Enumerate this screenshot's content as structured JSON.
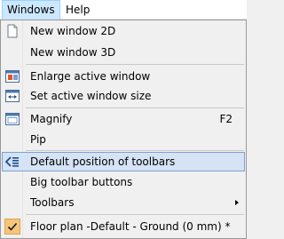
{
  "menubar": {
    "items": [
      {
        "label": "Windows",
        "active": true
      },
      {
        "label": "Help",
        "active": false
      }
    ]
  },
  "menu": {
    "new_window_2d": {
      "label": "New window 2D",
      "icon": "new-document-icon"
    },
    "new_window_3d": {
      "label": "New window 3D"
    },
    "enlarge_active_window": {
      "label": "Enlarge active window",
      "icon": "enlarge-window-icon"
    },
    "set_active_window_size": {
      "label": "Set active window size",
      "icon": "window-size-icon"
    },
    "magnify": {
      "label": "Magnify",
      "shortcut": "F2",
      "icon": "magnify-window-icon"
    },
    "pip": {
      "label": "Pip"
    },
    "default_position_of_toolbars": {
      "label": "Default position of toolbars",
      "icon": "toolbar-reset-icon",
      "highlighted": true
    },
    "big_toolbar_buttons": {
      "label": "Big toolbar buttons"
    },
    "toolbars": {
      "label": "Toolbars",
      "has_submenu": true
    },
    "floor_plan": {
      "label": "Floor plan -Default - Ground (0 mm) *",
      "checked": true
    }
  },
  "colors": {
    "menubar_active_bg": "#cce8ff",
    "hover_bg": "#d5e3f5",
    "hover_border": "#7da2ce",
    "check_bg": "#f4c57d"
  }
}
